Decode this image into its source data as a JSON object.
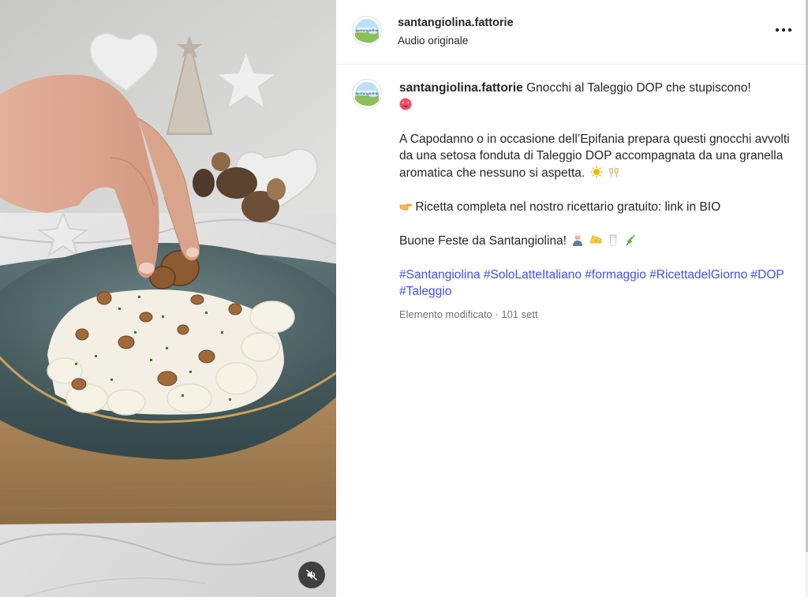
{
  "header": {
    "username": "santangiolina.fattorie",
    "audio": "Audio originale",
    "more_icon": "more-horizontal-icon"
  },
  "avatar": {
    "logo_text": "santangiolina",
    "colors": {
      "sky": "#bfe0f2",
      "hill": "#8cbf5a",
      "text": "#1d5fa3"
    }
  },
  "caption": {
    "username": "santangiolina.fattorie",
    "line1": "Gnocchi al Taleggio DOP che stupiscono!",
    "emoji1": "heart-eyes-emoji",
    "para2": "A Capodanno o in occasione dell’Epifania prepara questi gnocchi avvolti da una setosa fonduta di Taleggio DOP accompagnata da una granella aromatica che nessuno si aspetta.",
    "para2_emojis": [
      "sun-emoji",
      "clinking-glasses-emoji"
    ],
    "para3_emoji": "pointing-hand-emoji",
    "para3": "Ricetta completa nel nostro ricettario gratuito: link in BIO",
    "para4": "Buone Feste da Santangiolina!",
    "para4_emojis": [
      "cook-emoji",
      "cheese-emoji",
      "milk-glass-emoji",
      "herb-emoji"
    ],
    "hashtags": [
      "#Santangiolina",
      "#SoloLatteItaliano",
      "#formaggio",
      "#RicettadelGiorno",
      "#DOP",
      "#Taleggio"
    ]
  },
  "meta": {
    "text": "Elemento modificato · 101 sett"
  },
  "media": {
    "mute_icon": "speaker-muted-icon",
    "description_icon": "food-photo"
  },
  "colors": {
    "hashtag": "#4150f7",
    "text": "#262626",
    "meta": "#737373"
  }
}
